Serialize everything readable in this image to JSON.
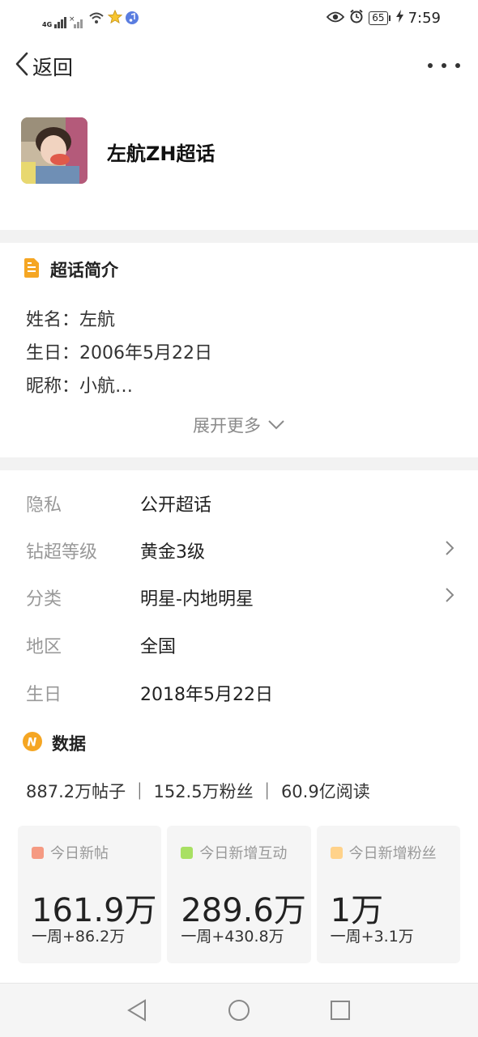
{
  "status_bar": {
    "signal_label": "4G",
    "time": "7:59",
    "battery": "65",
    "icons": [
      "signal-icon",
      "wifi-icon",
      "star-icon",
      "music-icon",
      "eye-icon",
      "alarm-icon",
      "battery-icon",
      "charging-icon"
    ]
  },
  "nav": {
    "back_label": "返回",
    "more_icon": "more-icon"
  },
  "header": {
    "topic_name": "左航ZH超话"
  },
  "intro": {
    "title": "超话简介",
    "lines": [
      "姓名：左航",
      "生日：2006年5月22日",
      "昵称：小航…"
    ],
    "expand_label": "展开更多"
  },
  "info": {
    "rows": [
      {
        "label": "隐私",
        "value": "公开超话"
      },
      {
        "label": "钻超等级",
        "value": "黄金3级"
      },
      {
        "label": "分类",
        "value": "明星-内地明星"
      },
      {
        "label": "地区",
        "value": "全国"
      },
      {
        "label": "生日",
        "value": "2018年5月22日"
      }
    ]
  },
  "data_section": {
    "title": "数据",
    "summary": "887.2万帖子 ｜ 152.5万粉丝 ｜ 60.9亿阅读",
    "cards": [
      {
        "label": "今日新帖",
        "value": "161.9万",
        "week": "一周+86.2万",
        "color": "#f59a82"
      },
      {
        "label": "今日新增互动",
        "value": "289.6万",
        "week": "一周+430.8万",
        "color": "#a8e063"
      },
      {
        "label": "今日新增粉丝",
        "value": "1万",
        "week": "一周+3.1万",
        "color": "#ffd28a"
      }
    ]
  },
  "colors": {
    "accent_orange": "#f5a623",
    "divider": "#f2f2f2"
  }
}
